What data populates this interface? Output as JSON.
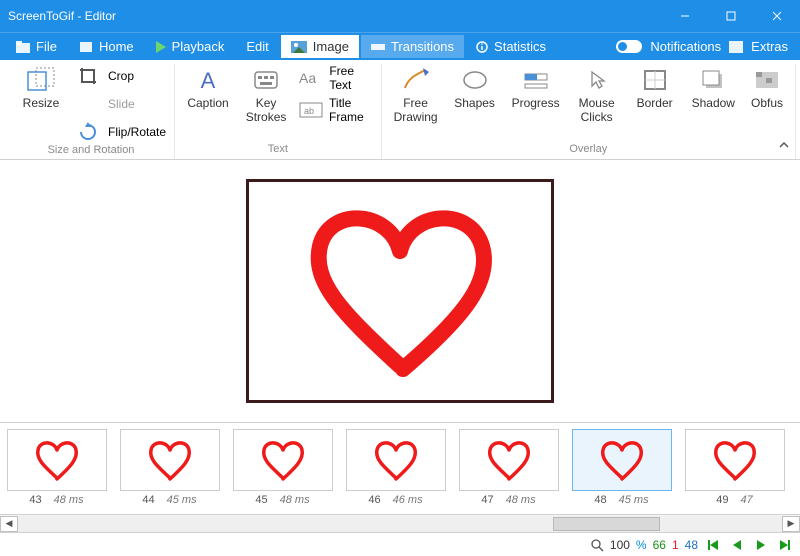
{
  "title": "ScreenToGif - Editor",
  "menu": {
    "file": "File",
    "home": "Home",
    "playback": "Playback",
    "edit": "Edit",
    "image": "Image",
    "transitions": "Transitions",
    "statistics": "Statistics",
    "notifications": "Notifications",
    "extras": "Extras"
  },
  "ribbon": {
    "resize": "Resize",
    "crop": "Crop",
    "slide": "Slide",
    "fliprotate": "Flip/Rotate",
    "group_size": "Size and Rotation",
    "caption": "Caption",
    "keystrokes": "Key\nStrokes",
    "freetext": "Free Text",
    "titleframe": "Title Frame",
    "group_text": "Text",
    "freedrawing": "Free\nDrawing",
    "shapes": "Shapes",
    "progress": "Progress",
    "mouseclicks": "Mouse\nClicks",
    "border": "Border",
    "shadow": "Shadow",
    "obfuscate": "Obfus",
    "group_overlay": "Overlay"
  },
  "thumbs": [
    {
      "num": "43",
      "ms": "48 ms"
    },
    {
      "num": "44",
      "ms": "45 ms"
    },
    {
      "num": "45",
      "ms": "48 ms"
    },
    {
      "num": "46",
      "ms": "46 ms"
    },
    {
      "num": "47",
      "ms": "48 ms"
    },
    {
      "num": "48",
      "ms": "45 ms"
    },
    {
      "num": "49",
      "ms": "47"
    }
  ],
  "selected_thumb": 5,
  "status": {
    "zoom": "100",
    "pct": "%",
    "green": "66",
    "red": "1",
    "blue": "48"
  }
}
